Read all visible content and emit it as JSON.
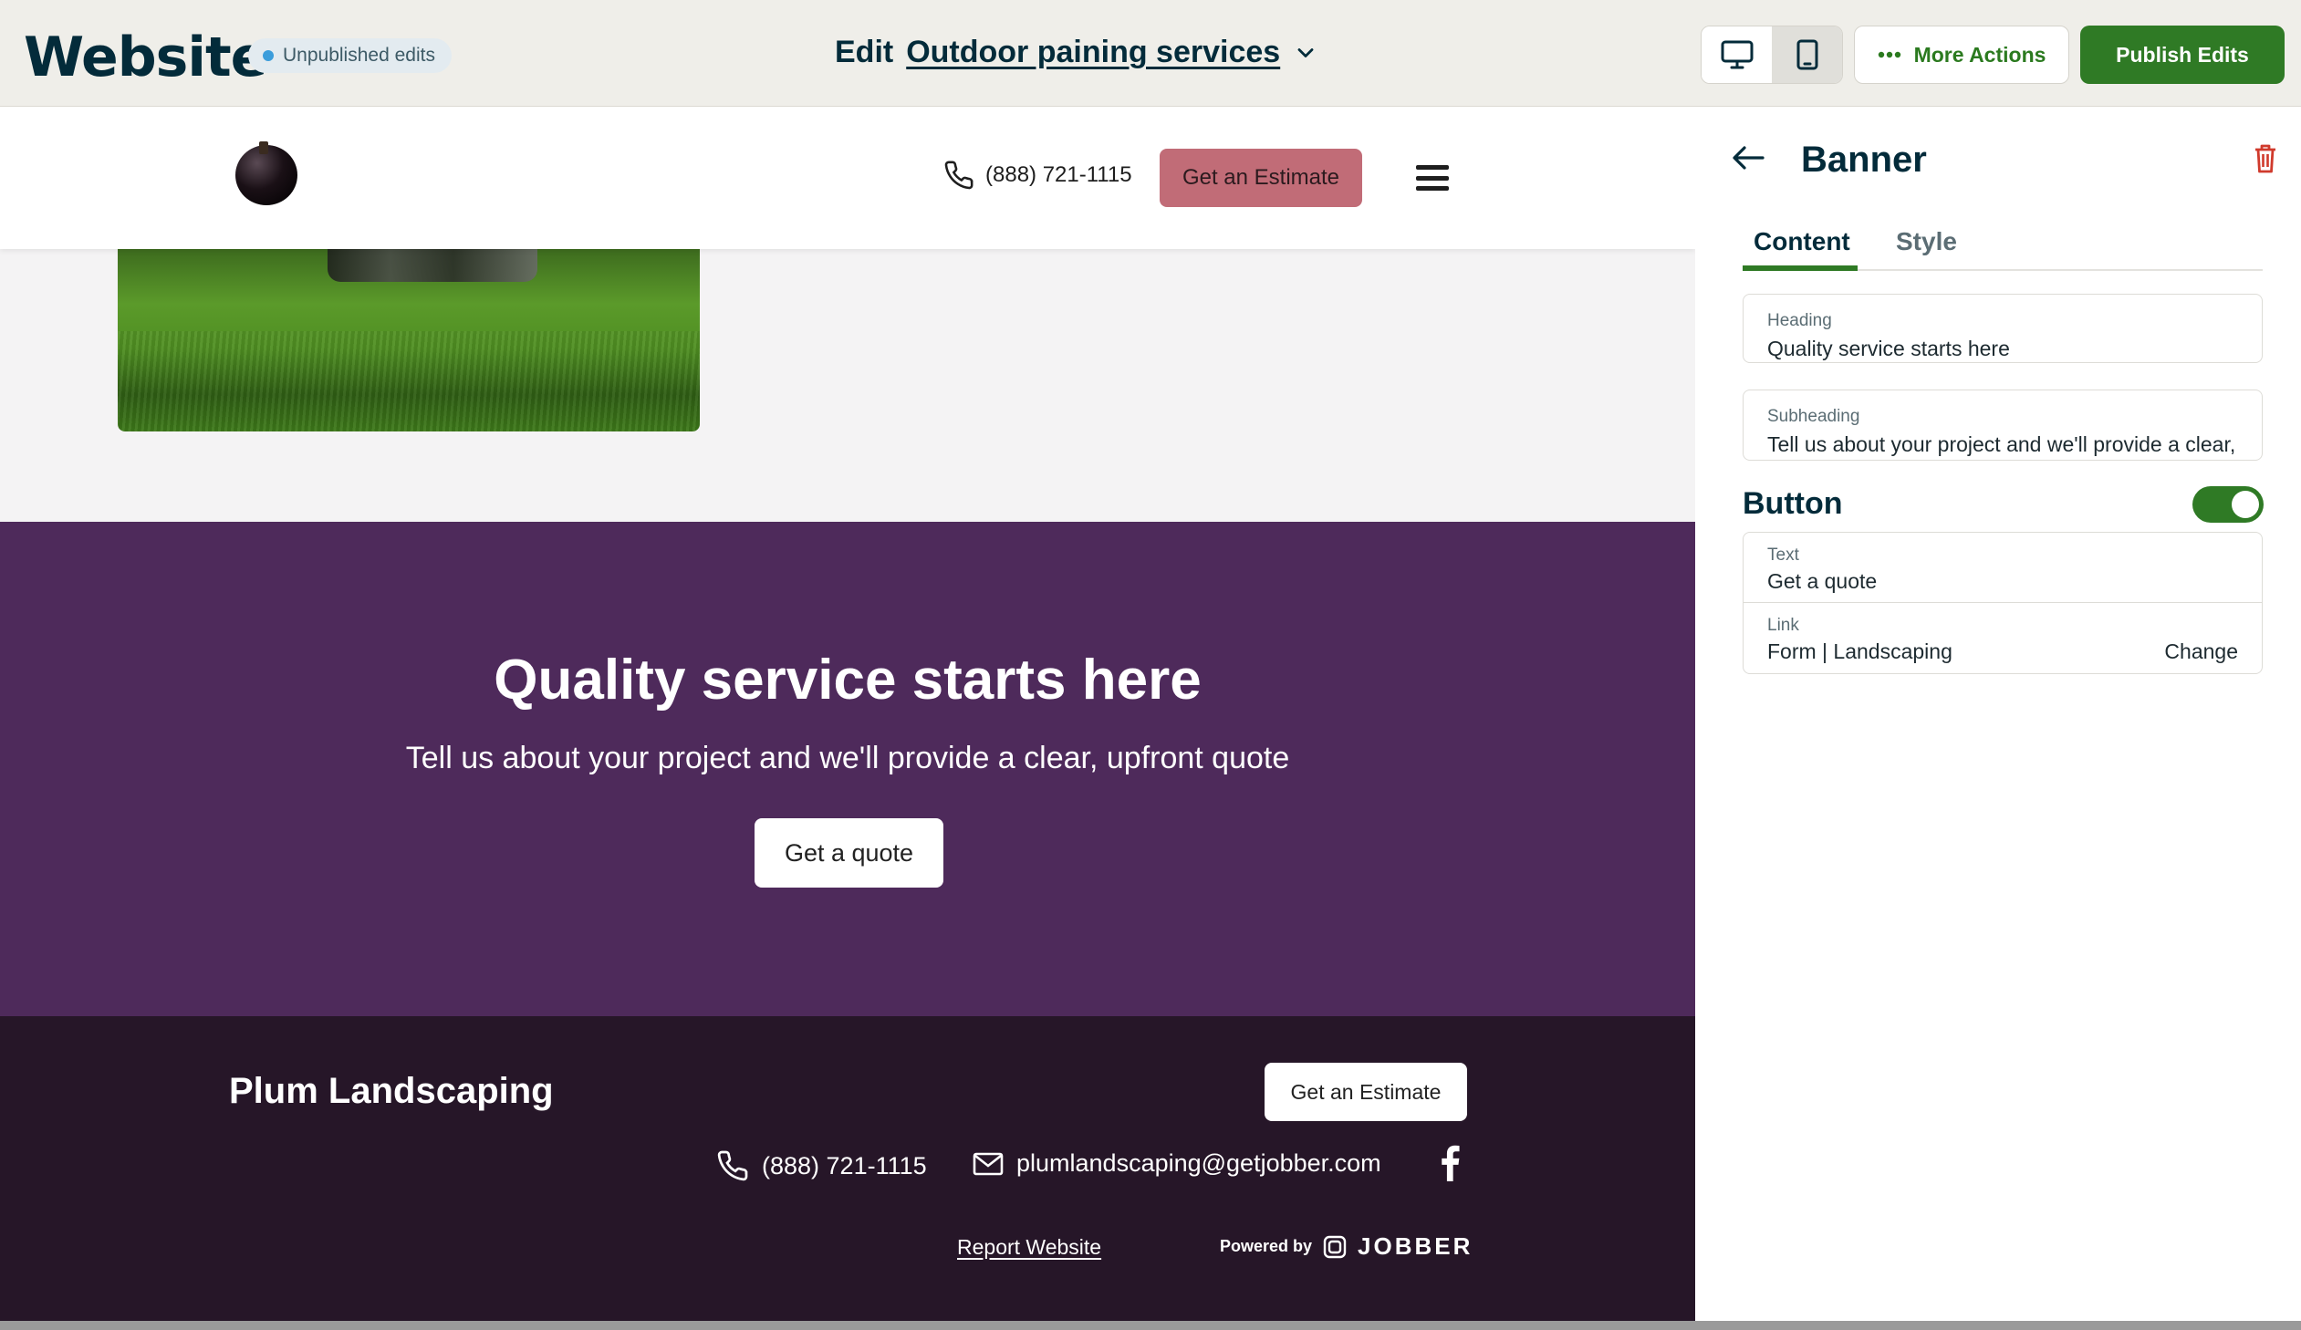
{
  "topbar": {
    "brand": "Website",
    "status_badge": "Unpublished edits",
    "edit_label": "Edit",
    "page_name": "Outdoor paining services",
    "more_actions": "More Actions",
    "publish": "Publish Edits",
    "accent_color": "#2f7a25"
  },
  "site_header": {
    "phone": "(888) 721-1115",
    "cta": "Get an Estimate"
  },
  "banner": {
    "heading": "Quality service starts here",
    "subheading": "Tell us about your project and we'll provide a clear, upfront quote",
    "button": "Get a quote",
    "background": "#4e2a5b"
  },
  "footer": {
    "business_name": "Plum Landscaping",
    "cta": "Get an Estimate",
    "phone": "(888) 721-1115",
    "email": "plumlandscaping@getjobber.com",
    "report": "Report Website",
    "powered_by": "Powered by",
    "jobber": "JOBBER"
  },
  "panel": {
    "title": "Banner",
    "tabs": [
      {
        "label": "Content",
        "active": true
      },
      {
        "label": "Style",
        "active": false
      }
    ],
    "heading_field": {
      "label": "Heading",
      "value": "Quality service starts here"
    },
    "subheading_field": {
      "label": "Subheading",
      "value": "Tell us about your project and we'll provide a clear, upfront quote"
    },
    "button_section": "Button",
    "button_enabled": true,
    "button_text": {
      "label": "Text",
      "value": "Get a quote"
    },
    "button_link": {
      "label": "Link",
      "value": "Form | Landscaping",
      "action": "Change"
    }
  }
}
